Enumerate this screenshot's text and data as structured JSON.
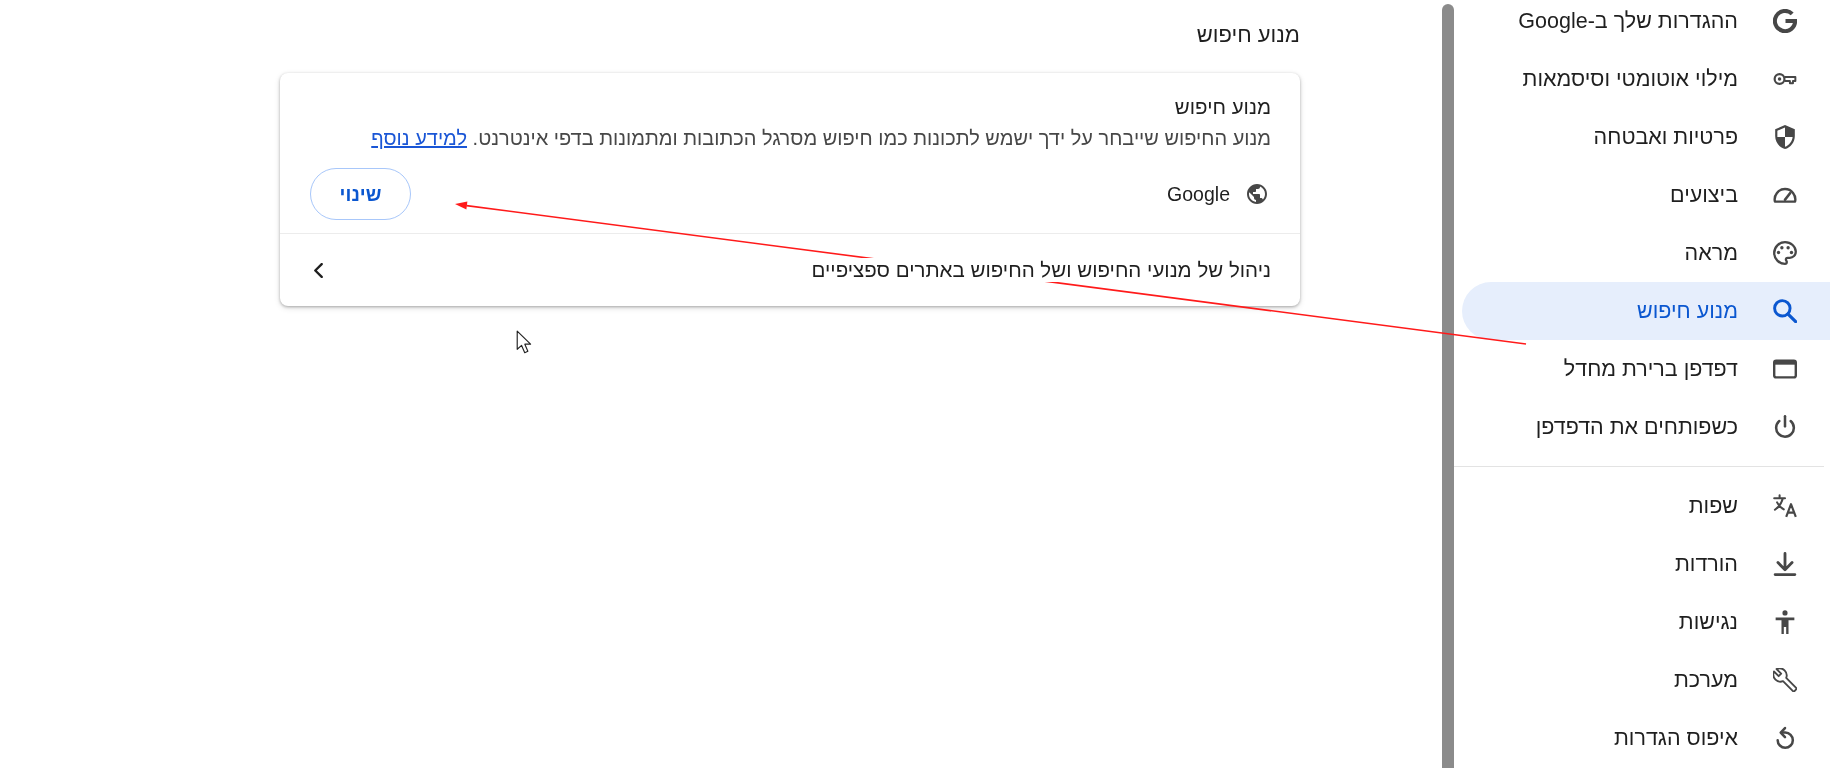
{
  "sidebar": {
    "sections": [
      {
        "items": [
          {
            "label": "ההגדרות שלך ב-Google",
            "selected": false
          },
          {
            "label": "מילוי אוטומטי וסיסמאות",
            "selected": false
          },
          {
            "label": "פרטיות ואבטחה",
            "selected": false
          },
          {
            "label": "ביצועים",
            "selected": false
          },
          {
            "label": "מראה",
            "selected": false
          },
          {
            "label": "מנוע חיפוש",
            "selected": true
          },
          {
            "label": "דפדפן ברירת מחדל",
            "selected": false
          },
          {
            "label": "כשפותחים את הדפדפן",
            "selected": false
          }
        ]
      },
      {
        "items": [
          {
            "label": "שפות",
            "selected": false
          },
          {
            "label": "הורדות",
            "selected": false
          },
          {
            "label": "נגישות",
            "selected": false
          },
          {
            "label": "מערכת",
            "selected": false
          },
          {
            "label": "איפוס הגדרות",
            "selected": false
          }
        ]
      }
    ]
  },
  "page_title": "מנוע חיפוש",
  "card": {
    "title": "מנוע חיפוש",
    "description": "מנוע החיפוש שייבחר על ידך ישמש לתכונות כמו חיפוש מסרגל הכתובות ומתמונות בדפי אינטרנט.",
    "link": "למידע נוסף",
    "engine": "Google",
    "change_button": "שינוי",
    "manage_row": "ניהול של מנועי החיפוש ושל החיפוש באתרים ספציפיים"
  }
}
